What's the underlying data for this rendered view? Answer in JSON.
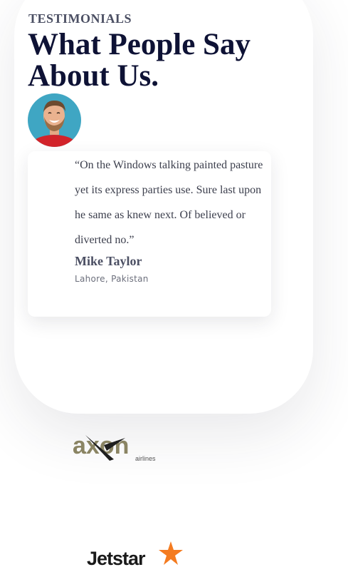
{
  "section": {
    "eyebrow": "TESTIMONIALS",
    "title_line1": "What People Say",
    "title_line2": "About Us."
  },
  "testimonial": {
    "quote": "“On the Windows talking painted pasture yet its express parties use. Sure last upon he same as knew next. Of believed or diverted no.”",
    "name": "Mike Taylor",
    "location": "Lahore,  Pakistan",
    "avatar_icon": "smiling-man-avatar"
  },
  "logos": [
    {
      "word": "axon",
      "sub": "airlines",
      "color": "#8a8463",
      "icon": "axon-airlines-logo"
    },
    {
      "word": "Jetstar",
      "color": "#1a1a1a",
      "accent": "#f47b20",
      "icon": "jetstar-star-logo"
    }
  ],
  "colors": {
    "heading": "#0e1235",
    "eyebrow": "#4b4f63",
    "body_text": "#3c3f4d"
  }
}
